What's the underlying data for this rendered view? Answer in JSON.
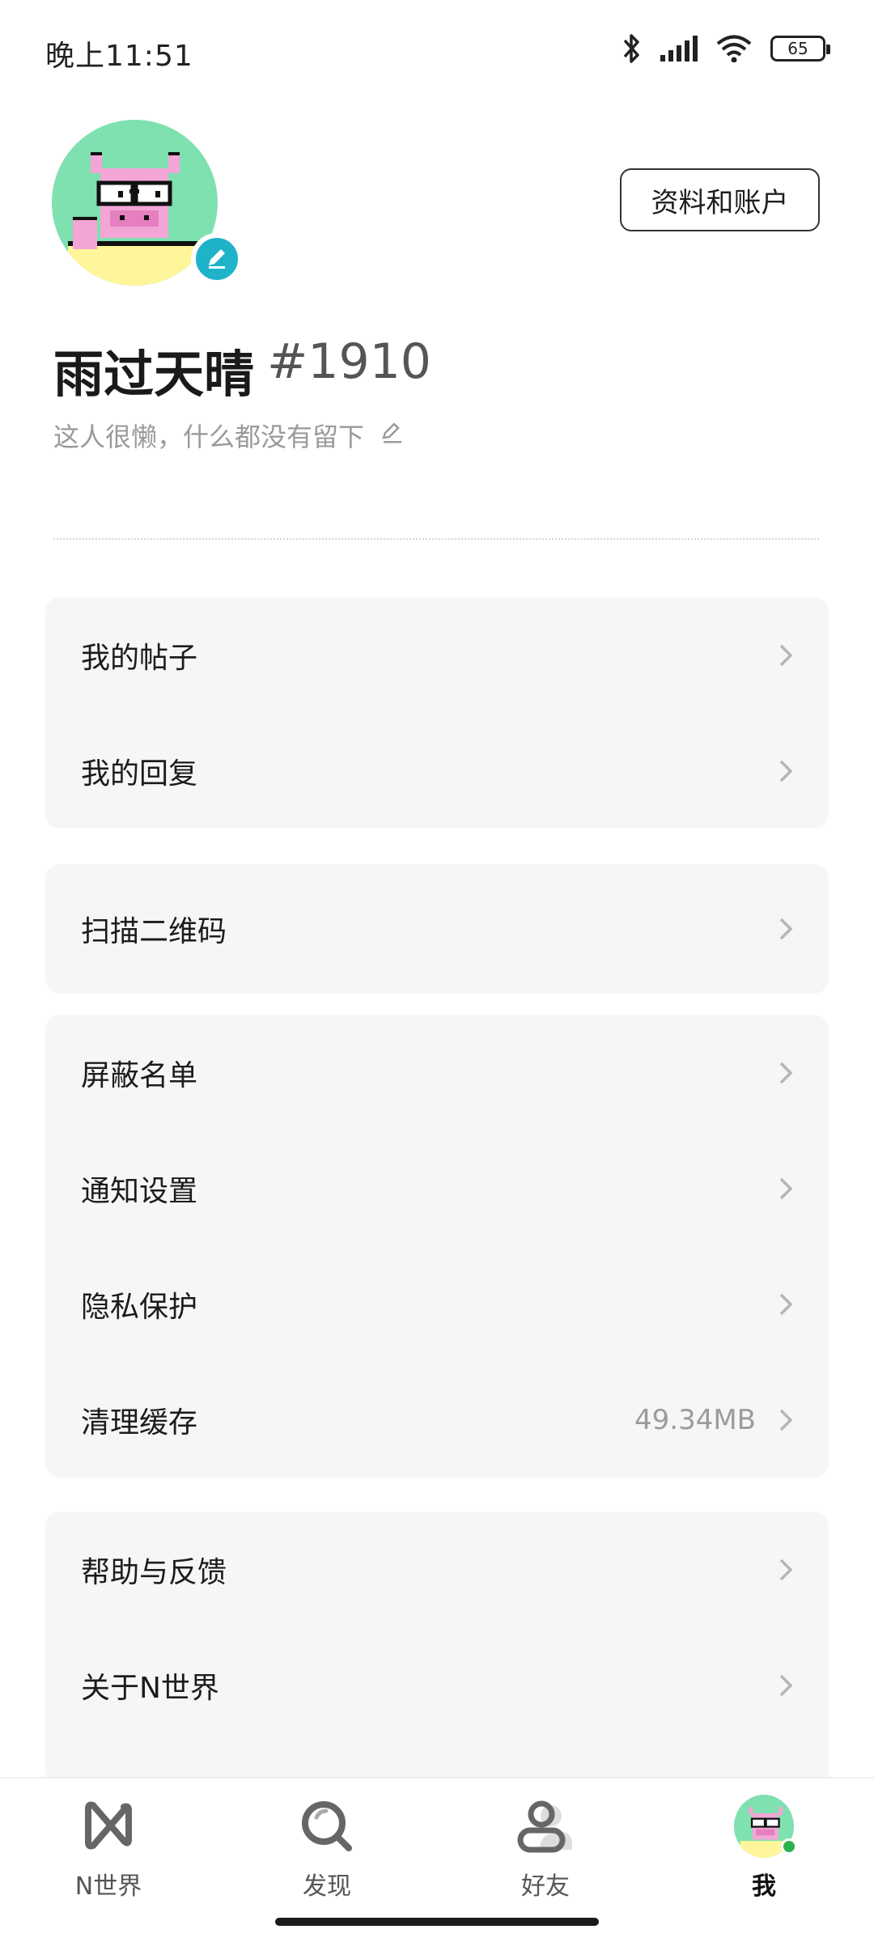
{
  "status_bar": {
    "time": "晚上11:51",
    "battery": "65"
  },
  "profile": {
    "name": "雨过天晴",
    "id": "#1910",
    "bio": "这人很懒，什么都没有留下",
    "account_button": "资料和账户"
  },
  "menu": {
    "group1": [
      {
        "label": "我的帖子"
      },
      {
        "label": "我的回复"
      }
    ],
    "group2": [
      {
        "label": "扫描二维码"
      }
    ],
    "group3": [
      {
        "label": "屏蔽名单"
      },
      {
        "label": "通知设置"
      },
      {
        "label": "隐私保护"
      },
      {
        "label": "清理缓存",
        "value": "49.34MB"
      }
    ],
    "group4": [
      {
        "label": "帮助与反馈"
      },
      {
        "label": "关于N世界"
      }
    ]
  },
  "bottom_nav": [
    {
      "label": "N世界",
      "icon": "n-world-icon"
    },
    {
      "label": "发现",
      "icon": "discover-icon"
    },
    {
      "label": "好友",
      "icon": "friends-icon"
    },
    {
      "label": "我",
      "icon": "avatar",
      "active": true
    }
  ],
  "colors": {
    "accent": "#1eb3c9",
    "online": "#2bb24c",
    "avatar_bg": "#7fe0b0",
    "card_bg": "#f6f6f6"
  }
}
